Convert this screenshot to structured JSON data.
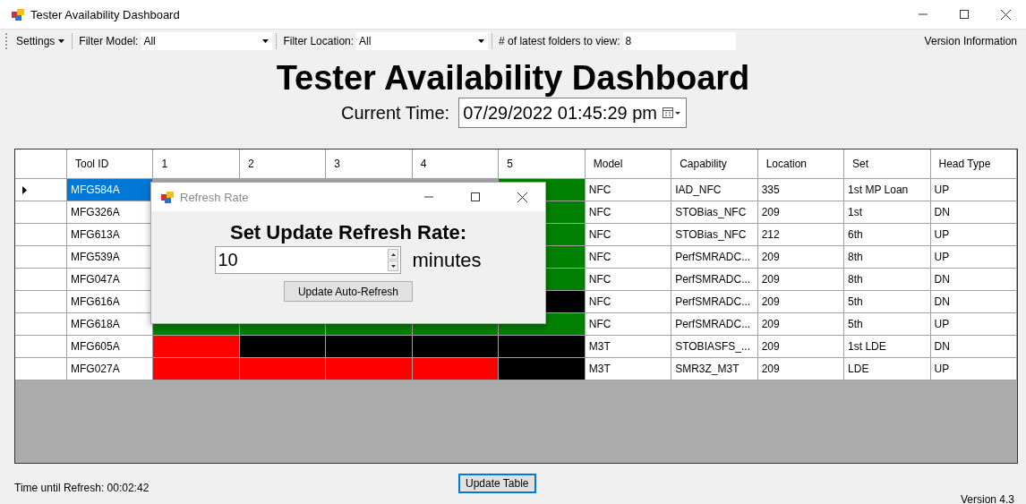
{
  "window": {
    "title": "Tester Availability Dashboard"
  },
  "toolbar": {
    "settings": "Settings",
    "filter_model": {
      "label": "Filter Model:",
      "value": "All"
    },
    "filter_location": {
      "label": "Filter Location:",
      "value": "All"
    },
    "folders": {
      "label": "# of latest folders to view:",
      "value": "8"
    },
    "version_info": "Version Information"
  },
  "heading": "Tester Availability Dashboard",
  "current_time": {
    "label": "Current Time:",
    "value": "07/29/2022 01:45:29 pm"
  },
  "table": {
    "columns": [
      "Tool ID",
      "1",
      "2",
      "3",
      "4",
      "5",
      "Model",
      "Capability",
      "Location",
      "Set",
      "Head Type"
    ],
    "rows": [
      {
        "selected": true,
        "tool_id": "MFG584A",
        "status": [
          {
            "color": "#008000"
          }
        ],
        "model": "NFC",
        "capability": "IAD_NFC",
        "location": "335",
        "set": "1st MP Loan",
        "head_type": "UP"
      },
      {
        "selected": false,
        "tool_id": "MFG326A",
        "status": [
          {
            "color": "#008000"
          }
        ],
        "model": "NFC",
        "capability": "STOBias_NFC",
        "location": "209",
        "set": "1st",
        "head_type": "DN"
      },
      {
        "selected": false,
        "tool_id": "MFG613A",
        "status": [
          {
            "color": "#008000"
          }
        ],
        "model": "NFC",
        "capability": "STOBias_NFC",
        "location": "212",
        "set": "6th",
        "head_type": "UP"
      },
      {
        "selected": false,
        "tool_id": "MFG539A",
        "status": [
          {
            "color": "#008000"
          }
        ],
        "model": "NFC",
        "capability": "PerfSMRADC...",
        "location": "209",
        "set": "8th",
        "head_type": "UP"
      },
      {
        "selected": false,
        "tool_id": "MFG047A",
        "status": [
          {
            "color": "#008000"
          }
        ],
        "model": "NFC",
        "capability": "PerfSMRADC...",
        "location": "209",
        "set": "8th",
        "head_type": "DN"
      },
      {
        "selected": false,
        "tool_id": "MFG616A",
        "status": [
          {
            "color": "#000000"
          }
        ],
        "model": "NFC",
        "capability": "PerfSMRADC...",
        "location": "209",
        "set": "5th",
        "head_type": "DN"
      },
      {
        "selected": false,
        "tool_id": "MFG618A",
        "status": [
          {
            "color": "#008000"
          },
          {
            "color": "#008000"
          },
          {
            "color": "#008000"
          },
          {
            "color": "#008000"
          },
          {
            "color": "#008000"
          }
        ],
        "model": "NFC",
        "capability": "PerfSMRADC...",
        "location": "209",
        "set": "5th",
        "head_type": "UP"
      },
      {
        "selected": false,
        "tool_id": "MFG605A",
        "status": [
          {
            "color": "#ff0000"
          },
          {
            "color": "#000000"
          },
          {
            "color": "#000000"
          },
          {
            "color": "#000000"
          },
          {
            "color": "#000000"
          }
        ],
        "model": "M3T",
        "capability": "STOBIASFS_...",
        "location": "209",
        "set": "1st LDE",
        "head_type": "DN"
      },
      {
        "selected": false,
        "tool_id": "MFG027A",
        "status": [
          {
            "color": "#ff0000"
          },
          {
            "color": "#ff0000"
          },
          {
            "color": "#ff0000"
          },
          {
            "color": "#ff0000"
          },
          {
            "color": "#000000"
          }
        ],
        "model": "M3T",
        "capability": "SMR3Z_M3T",
        "location": "209",
        "set": "LDE",
        "head_type": "UP"
      }
    ]
  },
  "footer": {
    "time_until_refresh": "Time until Refresh: 00:02:42",
    "update_button": "Update Table",
    "version": "Version 4.3"
  },
  "dialog": {
    "title": "Refresh Rate",
    "heading": "Set Update Refresh Rate:",
    "value": "10",
    "unit": "minutes",
    "button": "Update Auto-Refresh"
  }
}
